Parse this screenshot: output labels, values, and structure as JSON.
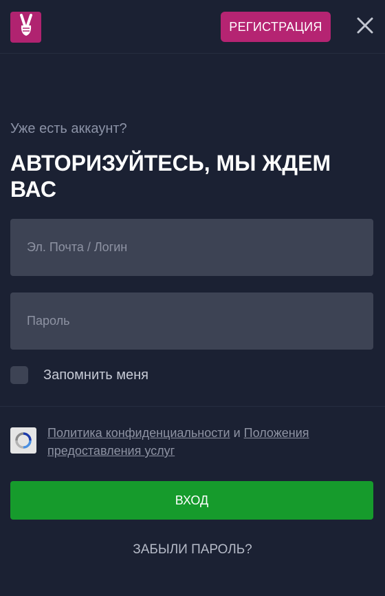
{
  "header": {
    "register_label": "РЕГИСТРАЦИЯ",
    "logo_icon": "victory-hand-icon",
    "close_icon": "close-icon",
    "brand_color": "#b02370"
  },
  "form": {
    "subtitle": "Уже есть аккаунт?",
    "title": "АВТОРИЗУЙТЕСЬ, МЫ ЖДЕМ ВАС",
    "email_placeholder": "Эл. Почта / Логин",
    "email_value": "",
    "password_placeholder": "Пароль",
    "password_value": "",
    "remember_label": "Запомнить меня",
    "remember_checked": false
  },
  "policy": {
    "recaptcha_icon": "recaptcha-icon",
    "privacy_link": "Политика конфиденциальности",
    "conjunction": "и",
    "terms_link": "Положения предоставления услуг"
  },
  "actions": {
    "login_label": "ВХОД",
    "login_color": "#169b2c",
    "forgot_label": "ЗАБЫЛИ ПАРОЛЬ?"
  }
}
